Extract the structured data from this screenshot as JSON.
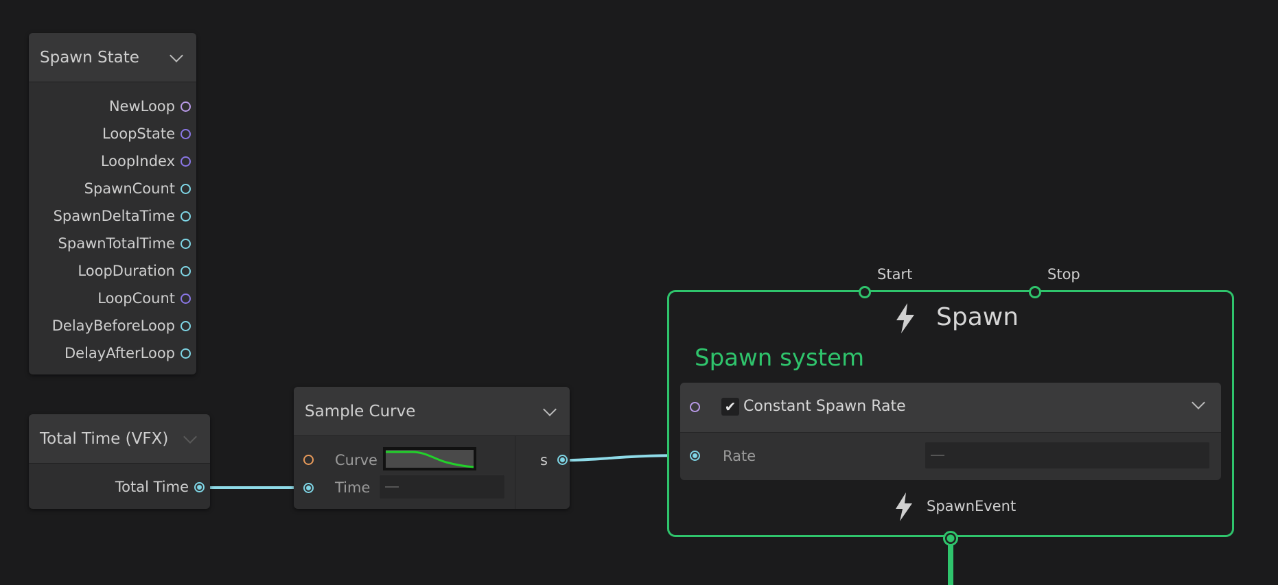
{
  "spawn_state": {
    "title": "Spawn State",
    "outputs": [
      {
        "label": "NewLoop",
        "color": "#b99ae8"
      },
      {
        "label": "LoopState",
        "color": "#8a77e6"
      },
      {
        "label": "LoopIndex",
        "color": "#8a77e6"
      },
      {
        "label": "SpawnCount",
        "color": "#7fd6e6"
      },
      {
        "label": "SpawnDeltaTime",
        "color": "#7fd6e6"
      },
      {
        "label": "SpawnTotalTime",
        "color": "#7fd6e6"
      },
      {
        "label": "LoopDuration",
        "color": "#7fd6e6"
      },
      {
        "label": "LoopCount",
        "color": "#8a77e6"
      },
      {
        "label": "DelayBeforeLoop",
        "color": "#7fd6e6"
      },
      {
        "label": "DelayAfterLoop",
        "color": "#7fd6e6"
      }
    ]
  },
  "total_time": {
    "title": "Total Time (VFX)",
    "output_label": "Total Time"
  },
  "sample_curve": {
    "title": "Sample Curve",
    "input_curve_label": "Curve",
    "input_time_label": "Time",
    "output_label": "s"
  },
  "spawn_context": {
    "start_label": "Start",
    "stop_label": "Stop",
    "title": "Spawn",
    "system_name": "Spawn system",
    "block_title": "Constant Spawn Rate",
    "block_checkmark": "✔",
    "rate_label": "Rate",
    "event_label": "SpawnEvent"
  },
  "colors": {
    "accent_green": "#2fc46c",
    "float_port": "#7fd6e6",
    "curve_green": "#22d12a"
  }
}
